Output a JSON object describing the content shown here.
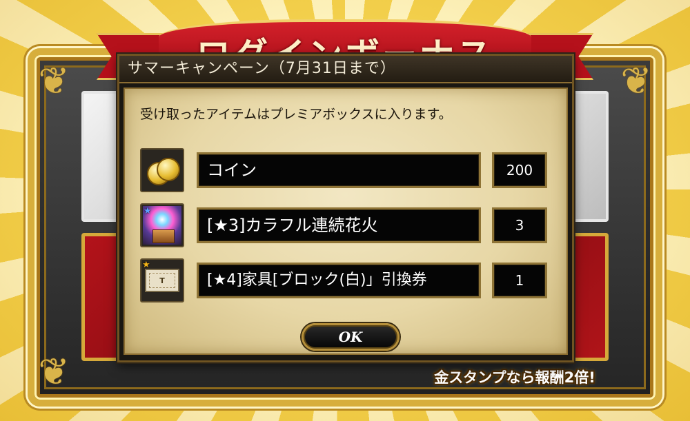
{
  "banner": {
    "title": "ログインボーナス"
  },
  "footer": {
    "note": "金スタンプなら報酬2倍!"
  },
  "dialog": {
    "title": "サマーキャンペーン（7月31日まで）",
    "message": "受け取ったアイテムはプレミアボックスに入ります。",
    "items": [
      {
        "name": "コイン",
        "quantity": "200",
        "icon": "coin-icon"
      },
      {
        "name": "[★3]カラフル連続花火",
        "quantity": "3",
        "icon": "firework-icon"
      },
      {
        "name": "[★4]家具[ブロック(白)」引換券",
        "quantity": "1",
        "icon": "exchange-ticket-icon"
      }
    ],
    "ok_label": "OK"
  },
  "colors": {
    "dialog_body": "#e7d7a6",
    "frame_gold": "#d7ae3c",
    "ribbon_red": "#b5111b"
  }
}
